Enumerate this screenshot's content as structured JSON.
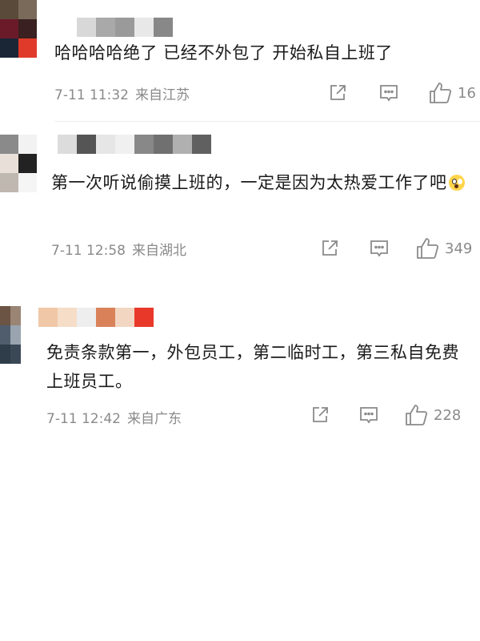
{
  "colors": {
    "meta_text": "#8a8a8a",
    "body_text": "#1a1a1a",
    "background": "#ffffff"
  },
  "comments": [
    {
      "text": "哈哈哈哈绝了 已经不外包了 开始私自上班了",
      "time": "7-11 11:32",
      "location": "来自江苏",
      "likes": "16",
      "avatar_colors": [
        "#5a4a3a",
        "#7a6a5a",
        "#6b1a2a",
        "#3a2020",
        "#1a2535",
        "#e03a2a"
      ],
      "username_colors": [
        "#d8d8d8",
        "#a9a9a9",
        "#9a9a9a",
        "#e8e8e8",
        "#888888"
      ]
    },
    {
      "text": "第一次听说偷摸上班的，一定是因为太热爱工作了吧",
      "emoji": "astonished-face",
      "time": "7-11 12:58",
      "location": "来自湖北",
      "likes": "349",
      "avatar_colors": [
        "#8a8a8a",
        "#f2f2f2",
        "#e8e0d8",
        "#222222",
        "#bfb8b0",
        "#f5f5f5"
      ],
      "username_colors": [
        "#dcdcdc",
        "#555555",
        "#e6e6e6",
        "#f0f0f0",
        "#888888",
        "#707070",
        "#b0b0b0",
        "#606060"
      ]
    },
    {
      "text": "免责条款第一，外包员工，第二临时工，第三私自免费上班员工。",
      "time": "7-11 12:42",
      "location": "来自广东",
      "likes": "228",
      "avatar_colors": [
        "#6b5444",
        "#9a8474",
        "#4f5d6d",
        "#9aa4b0",
        "#2f3d4a",
        "#3a4856"
      ],
      "username_colors": [
        "#f0c8a8",
        "#f5ddc8",
        "#eeeeee",
        "#d9825a",
        "#f2d6c2",
        "#e8382a"
      ]
    }
  ]
}
